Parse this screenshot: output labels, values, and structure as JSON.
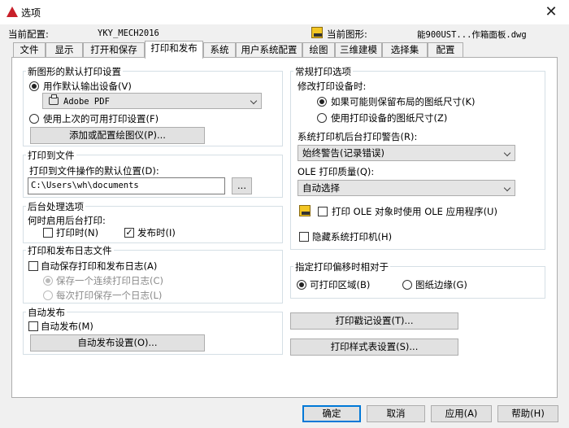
{
  "window": {
    "title": "选项",
    "close": "✕"
  },
  "header": {
    "current_profile_label": "当前配置:",
    "current_profile_value": "YKY_MECH2016",
    "current_drawing_label": "当前图形:",
    "current_drawing_value": "能900UST...作箱面板.dwg"
  },
  "tabs": [
    "文件",
    "显示",
    "打开和保存",
    "打印和发布",
    "系统",
    "用户系统配置",
    "绘图",
    "三维建模",
    "选择集",
    "配置"
  ],
  "active_tab": "打印和发布",
  "new_drawing_defaults": {
    "title": "新图形的默认打印设置",
    "use_default_device": "用作默认输出设备(V)",
    "device_value": "Adobe PDF",
    "use_last_settings": "使用上次的可用打印设置(F)",
    "add_plotter": "添加或配置绘图仪(P)..."
  },
  "plot_to_file": {
    "title": "打印到文件",
    "label": "打印到文件操作的默认位置(D):",
    "path": "C:\\Users\\wh\\documents",
    "browse": "..."
  },
  "background": {
    "title": "后台处理选项",
    "label": "何时启用后台打印:",
    "plotting": "打印时(N)",
    "publishing": "发布时(I)",
    "plotting_checked": false,
    "publishing_checked": true
  },
  "log": {
    "title": "打印和发布日志文件",
    "auto_save": "自动保存打印和发布日志(A)",
    "continuous": "保存一个连续打印日志(C)",
    "per_plot": "每次打印保存一个日志(L)"
  },
  "autopublish": {
    "title": "自动发布",
    "checkbox": "自动发布(M)",
    "settings": "自动发布设置(O)..."
  },
  "general": {
    "title": "常规打印选项",
    "change_device_label": "修改打印设备时:",
    "keep_layout": "如果可能则保留布局的图纸尺寸(K)",
    "use_device_size": "使用打印设备的图纸尺寸(Z)",
    "spool_alert_label": "系统打印机后台打印警告(R):",
    "spool_alert_value": "始终警告(记录错误)",
    "ole_quality_label": "OLE 打印质量(Q):",
    "ole_quality_value": "自动选择",
    "ole_app": "打印 OLE 对象时使用 OLE 应用程序(U)",
    "hide_printers": "隐藏系统打印机(H)"
  },
  "offset": {
    "title": "指定打印偏移时相对于",
    "printable_area": "可打印区域(B)",
    "paper_edge": "图纸边缘(G)"
  },
  "right_buttons": {
    "stamp": "打印戳记设置(T)...",
    "style_table": "打印样式表设置(S)..."
  },
  "footer": {
    "ok": "确定",
    "cancel": "取消",
    "apply": "应用(A)",
    "help": "帮助(H)"
  }
}
